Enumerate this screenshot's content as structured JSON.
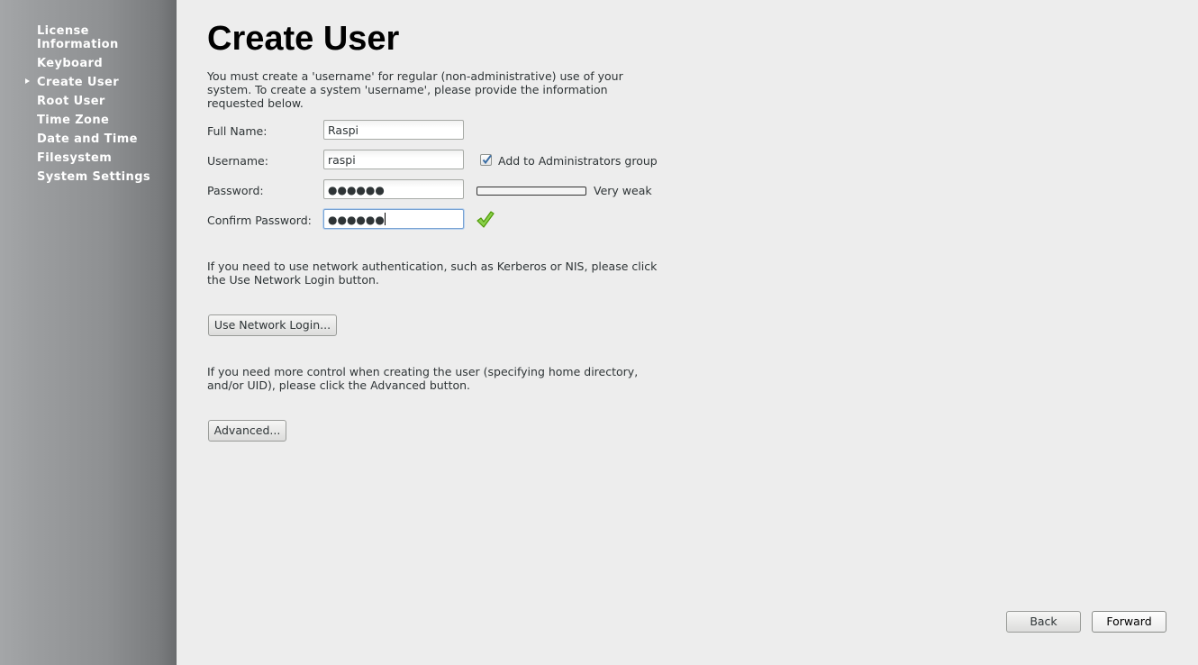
{
  "sidebar": {
    "items": [
      {
        "label": "License\nInformation"
      },
      {
        "label": "Keyboard"
      },
      {
        "label": "Create User"
      },
      {
        "label": "Root User"
      },
      {
        "label": "Time Zone"
      },
      {
        "label": "Date and Time"
      },
      {
        "label": "Filesystem"
      },
      {
        "label": "System Settings"
      }
    ],
    "active_index": 2
  },
  "main": {
    "title": "Create User",
    "intro": "You must create a 'username' for regular (non-administrative) use of your system.  To create a system 'username', please provide the information requested below.",
    "form": {
      "full_name_label": "Full Name:",
      "full_name_value": "Raspi",
      "username_label": "Username:",
      "username_value": "raspi",
      "admin_checkbox_label": "Add to Administrators group",
      "admin_checked": true,
      "password_label": "Password:",
      "password_value": "●●●●●●",
      "password_strength_label": "Very weak",
      "password_strength_level": 0,
      "confirm_label": "Confirm Password:",
      "confirm_value": "●●●●●●"
    },
    "network_text": "If you need to use network authentication, such as Kerberos or NIS, please click the Use Network Login button.",
    "network_button": "Use Network Login...",
    "advanced_text": "If you need more control when creating the user (specifying home directory, and/or UID), please click the Advanced button.",
    "advanced_button": "Advanced..."
  },
  "footer": {
    "back_label": "Back",
    "forward_label": "Forward"
  }
}
